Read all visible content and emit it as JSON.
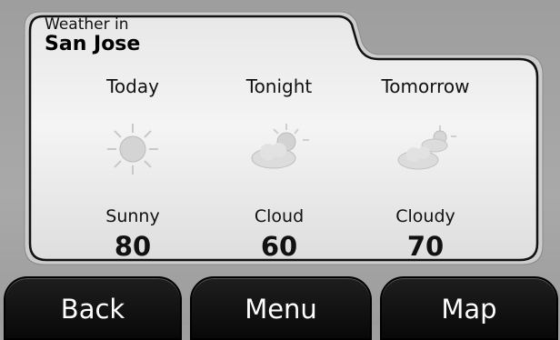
{
  "header": {
    "title_prefix": "Weather in",
    "city": "San Jose"
  },
  "forecast": [
    {
      "period": "Today",
      "condition": "Sunny",
      "temperature": "80",
      "icon": "sun-icon"
    },
    {
      "period": "Tonight",
      "condition": "Cloud",
      "temperature": "60",
      "icon": "partly-cloudy-icon"
    },
    {
      "period": "Tomorrow",
      "condition": "Cloudy",
      "temperature": "70",
      "icon": "cloudy-icon"
    }
  ],
  "buttons": {
    "back": "Back",
    "menu": "Menu",
    "map": "Map"
  }
}
